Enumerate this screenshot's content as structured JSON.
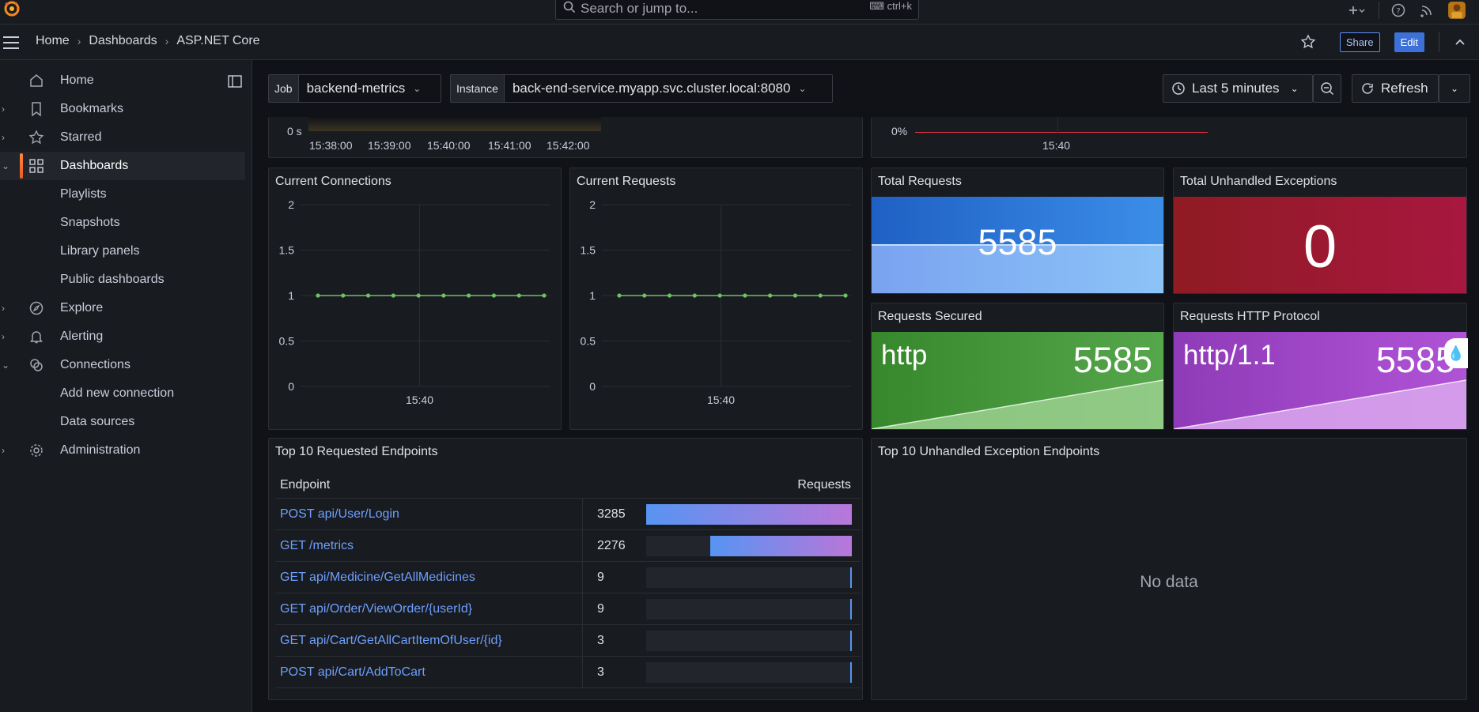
{
  "topbar": {
    "search_placeholder": "Search or jump to...",
    "search_shortcut": "ctrl+k"
  },
  "breadcrumb": {
    "home": "Home",
    "dashboards": "Dashboards",
    "current": "ASP.NET Core"
  },
  "nav_actions": {
    "share": "Share",
    "edit": "Edit"
  },
  "sidebar": {
    "items": [
      {
        "label": "Home",
        "icon": "home-icon"
      },
      {
        "label": "Bookmarks",
        "icon": "bookmark-icon"
      },
      {
        "label": "Starred",
        "icon": "star-icon"
      },
      {
        "label": "Dashboards",
        "icon": "apps-icon"
      },
      {
        "label": "Playlists"
      },
      {
        "label": "Snapshots"
      },
      {
        "label": "Library panels"
      },
      {
        "label": "Public dashboards"
      },
      {
        "label": "Explore",
        "icon": "compass-icon"
      },
      {
        "label": "Alerting",
        "icon": "bell-icon"
      },
      {
        "label": "Connections",
        "icon": "connections-icon"
      },
      {
        "label": "Add new connection"
      },
      {
        "label": "Data sources"
      },
      {
        "label": "Administration",
        "icon": "cog-icon"
      }
    ]
  },
  "variables": {
    "job_label": "Job",
    "job_value": "backend-metrics",
    "instance_label": "Instance",
    "instance_value": "back-end-service.myapp.svc.cluster.local:8080"
  },
  "time": {
    "range": "Last 5 minutes",
    "refresh": "Refresh"
  },
  "top_partial": {
    "left_tick_y": "0 s",
    "left_ticks_x": [
      "15:38:00",
      "15:39:00",
      "15:40:00",
      "15:41:00",
      "15:42:00"
    ],
    "right_tick_y": "0%",
    "right_tick_x": "15:40"
  },
  "panels": {
    "connections_title": "Current Connections",
    "requests_title": "Current Requests",
    "total_requests_title": "Total Requests",
    "total_requests_value": "5585",
    "unhandled_title": "Total Unhandled Exceptions",
    "unhandled_value": "0",
    "secured_title": "Requests Secured",
    "secured_label": "http",
    "secured_value": "5585",
    "protocol_title": "Requests HTTP Protocol",
    "protocol_label": "http/1.1",
    "protocol_value": "5585",
    "top_endpoints_title": "Top 10 Requested Endpoints",
    "top_exceptions_title": "Top 10 Unhandled Exception Endpoints",
    "no_data": "No data"
  },
  "table": {
    "col_endpoint": "Endpoint",
    "col_requests": "Requests",
    "rows": [
      {
        "endpoint": "POST api/User/Login",
        "count": "3285",
        "fraction": 1.0
      },
      {
        "endpoint": "GET /metrics",
        "count": "2276",
        "fraction": 0.69
      },
      {
        "endpoint": "GET api/Medicine/GetAllMedicines",
        "count": "9",
        "fraction": 0.003
      },
      {
        "endpoint": "GET api/Order/ViewOrder/{userId}",
        "count": "9",
        "fraction": 0.003
      },
      {
        "endpoint": "GET api/Cart/GetAllCartItemOfUser/{id}",
        "count": "3",
        "fraction": 0.001
      },
      {
        "endpoint": "POST api/Cart/AddToCart",
        "count": "3",
        "fraction": 0.001
      }
    ]
  },
  "chart_data": [
    {
      "type": "line",
      "title": "Current Connections",
      "x_tick_labels": [
        "15:40"
      ],
      "y_tick_labels": [
        "0",
        "0.5",
        "1",
        "1.5",
        "2"
      ],
      "ylim": [
        0,
        2
      ],
      "series": [
        {
          "values": [
            1,
            1,
            1,
            1,
            1,
            1,
            1,
            1,
            1,
            1
          ],
          "color": "#73bf69"
        }
      ]
    },
    {
      "type": "line",
      "title": "Current Requests",
      "x_tick_labels": [
        "15:40"
      ],
      "y_tick_labels": [
        "0",
        "0.5",
        "1",
        "1.5",
        "2"
      ],
      "ylim": [
        0,
        2
      ],
      "series": [
        {
          "values": [
            1,
            1,
            1,
            1,
            1,
            1,
            1,
            1,
            1,
            1
          ],
          "color": "#73bf69"
        }
      ]
    }
  ],
  "colors": {
    "accent_blue": "#3d71d9",
    "link_blue": "#6e9fff",
    "green": "#73bf69",
    "stat_blue": "#1f60c4",
    "stat_red": "#8f1b23",
    "stat_green": "#37872d",
    "stat_purple": "#8f3bb8"
  }
}
